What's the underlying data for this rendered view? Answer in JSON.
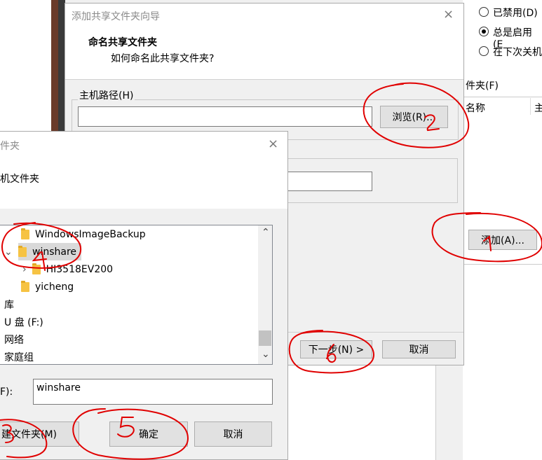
{
  "back_window": {
    "radio_options": [
      {
        "label": "已禁用(D)",
        "selected": false
      },
      {
        "label": "总是启用(E",
        "selected": true
      },
      {
        "label": "在下次关机",
        "selected": false
      }
    ],
    "shared_folders_label": "件夹(F)",
    "columns": [
      "名称",
      "主"
    ],
    "add_button": "添加(A)..."
  },
  "wizard": {
    "title": "添加共享文件夹向导",
    "heading": "命名共享文件夹",
    "subheading": "如何命名此共享文件夹?",
    "host_path_label": "主机路径(H)",
    "host_path_value": "",
    "browse_button": "浏览(R)...",
    "name_value": "",
    "next_button": "下一步(N) >",
    "cancel_button": "取消"
  },
  "browse_dialog": {
    "title": "件夹",
    "instruction": "机文件夹",
    "tree": [
      {
        "label": "WindowsImageBackup",
        "level": 1,
        "expander": "",
        "folder": true,
        "selected": false
      },
      {
        "label": "winshare",
        "level": 1,
        "expander": "⌄",
        "folder": true,
        "selected": true
      },
      {
        "label": "HI3518EV200",
        "level": 2,
        "expander": "›",
        "folder": true,
        "selected": false
      },
      {
        "label": "yicheng",
        "level": 1,
        "expander": "",
        "folder": true,
        "selected": false
      },
      {
        "label": "库",
        "level": 0,
        "expander": "",
        "folder": false,
        "selected": false
      },
      {
        "label": "U 盘 (F:)",
        "level": 0,
        "expander": "",
        "folder": false,
        "selected": false
      },
      {
        "label": "网络",
        "level": 0,
        "expander": "",
        "folder": false,
        "selected": false
      },
      {
        "label": "家庭组",
        "level": 0,
        "expander": "",
        "folder": false,
        "selected": false
      }
    ],
    "folder_label": "F):",
    "folder_value": "winshare",
    "new_folder_button": "建文件夹(M)",
    "ok_button": "确定",
    "cancel_button": "取消"
  },
  "icons": {
    "close": "×",
    "scroll_up": "⌃",
    "scroll_down": "⌄"
  }
}
